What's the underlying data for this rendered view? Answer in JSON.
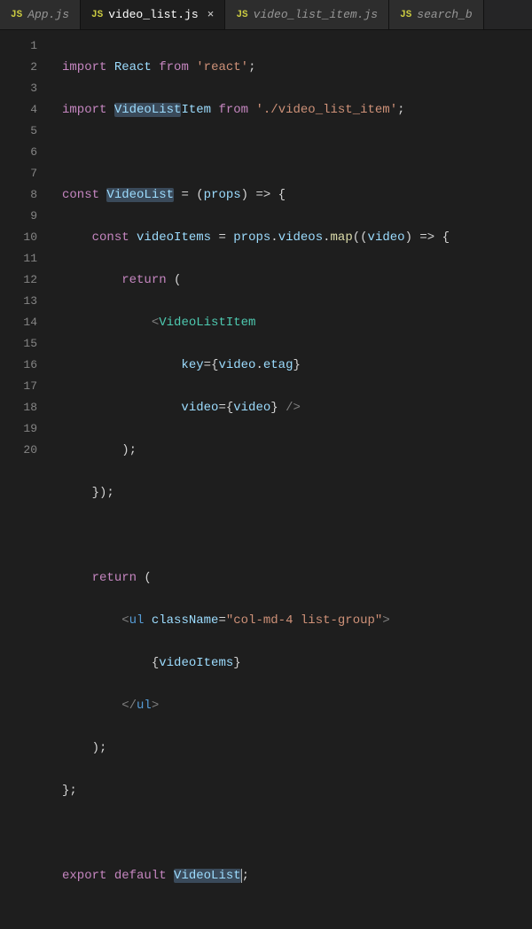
{
  "tabs": [
    {
      "label": "App.js",
      "active": false,
      "closeable": false
    },
    {
      "label": "video_list.js",
      "active": true,
      "closeable": true
    },
    {
      "label": "video_list_item.js",
      "active": false,
      "closeable": false
    },
    {
      "label": "search_b",
      "active": false,
      "closeable": false
    }
  ],
  "close_glyph": "×",
  "lines": [
    1,
    2,
    3,
    4,
    5,
    6,
    7,
    8,
    9,
    10,
    11,
    12,
    13,
    14,
    15,
    16,
    17,
    18,
    19,
    20
  ],
  "code": {
    "l1": {
      "kw1": "import",
      "v1": "React",
      "kw2": "from",
      "s1": "'react'",
      "end": ";"
    },
    "l2": {
      "kw1": "import",
      "v1": "VideoList",
      "v2": "Item",
      "kw2": "from",
      "s1": "'./video_list_item'",
      "end": ";"
    },
    "l4": {
      "kw1": "const",
      "v1": "VideoList",
      "eq": " = (",
      "p": "props",
      "arr": ") => {"
    },
    "l5": {
      "kw1": "const",
      "v1": "videoItems",
      "eq": " = ",
      "p": "props",
      "dot1": ".",
      "p2": "videos",
      "dot2": ".",
      "fn": "map",
      "open": "((",
      "arg": "video",
      "arr": ") => {"
    },
    "l6": {
      "kw1": "return",
      "open": " ("
    },
    "l7": {
      "open": "<",
      "tag": "VideoListItem"
    },
    "l8": {
      "a": "key",
      "eq": "={",
      "v": "video",
      "dot": ".",
      "p": "etag",
      "close": "}"
    },
    "l9": {
      "a": "video",
      "eq": "={",
      "v": "video",
      "close": "} ",
      "end": "/>"
    },
    "l10": {
      "txt": ");"
    },
    "l11": {
      "txt": "});"
    },
    "l13": {
      "kw1": "return",
      "open": " ("
    },
    "l14": {
      "open": "<",
      "tag": "ul",
      "sp": " ",
      "a": "className",
      "eq": "=",
      "s": "\"col-md-4 list-group\"",
      "close": ">"
    },
    "l15": {
      "open": "{",
      "v": "videoItems",
      "close": "}"
    },
    "l16": {
      "open": "</",
      "tag": "ul",
      "close": ">"
    },
    "l17": {
      "txt": ");"
    },
    "l18": {
      "txt": "};"
    },
    "l20": {
      "kw1": "export",
      "kw2": "default",
      "v": "VideoList",
      "end": ";"
    }
  }
}
